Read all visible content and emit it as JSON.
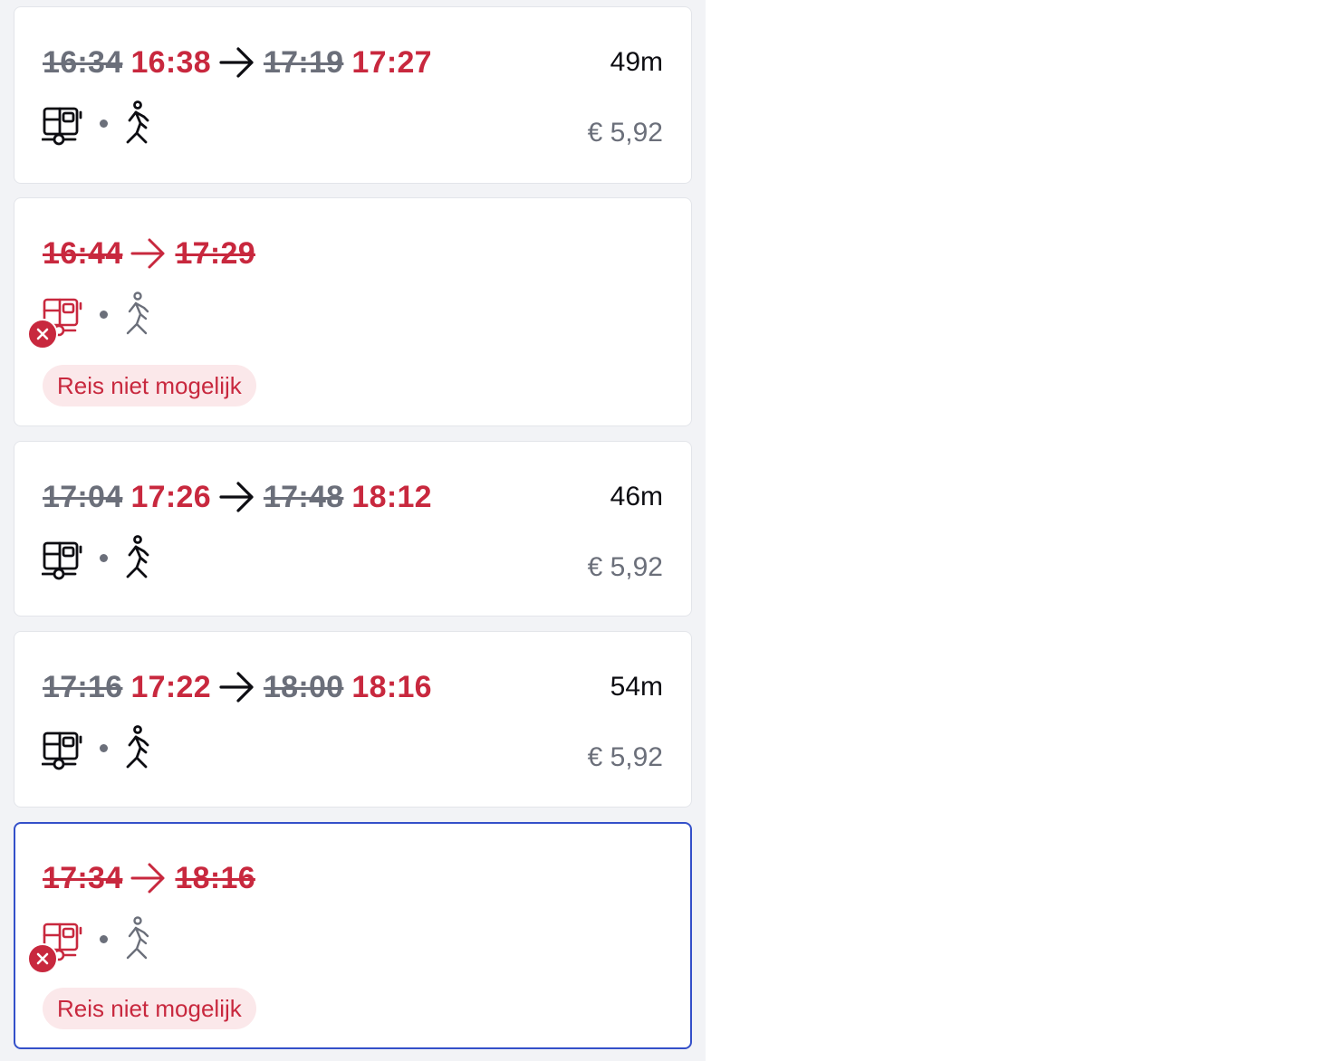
{
  "colors": {
    "delay_red": "#c8283e",
    "muted_gray": "#6b6f7a",
    "selected_border": "#3450c9",
    "pill_bg": "#fbe8ea"
  },
  "icons": {
    "arrow": "arrow-right-icon",
    "transit": "bus-icon",
    "walk": "walking-icon",
    "cancelled": "cancel-x-icon"
  },
  "journeys": [
    {
      "departure_planned": "16:34",
      "departure_actual": "16:38",
      "arrival_planned": "17:19",
      "arrival_actual": "17:27",
      "duration": "49m",
      "price": "€ 5,92",
      "cancelled": false
    },
    {
      "departure_planned": "16:44",
      "arrival_planned": "17:29",
      "status": "Reis niet mogelijk",
      "cancelled": true
    },
    {
      "departure_planned": "17:04",
      "departure_actual": "17:26",
      "arrival_planned": "17:48",
      "arrival_actual": "18:12",
      "duration": "46m",
      "price": "€ 5,92",
      "cancelled": false
    },
    {
      "departure_planned": "17:16",
      "departure_actual": "17:22",
      "arrival_planned": "18:00",
      "arrival_actual": "18:16",
      "duration": "54m",
      "price": "€ 5,92",
      "cancelled": false
    },
    {
      "departure_planned": "17:34",
      "arrival_planned": "18:16",
      "status": "Reis niet mogelijk",
      "cancelled": true,
      "selected": true
    }
  ]
}
